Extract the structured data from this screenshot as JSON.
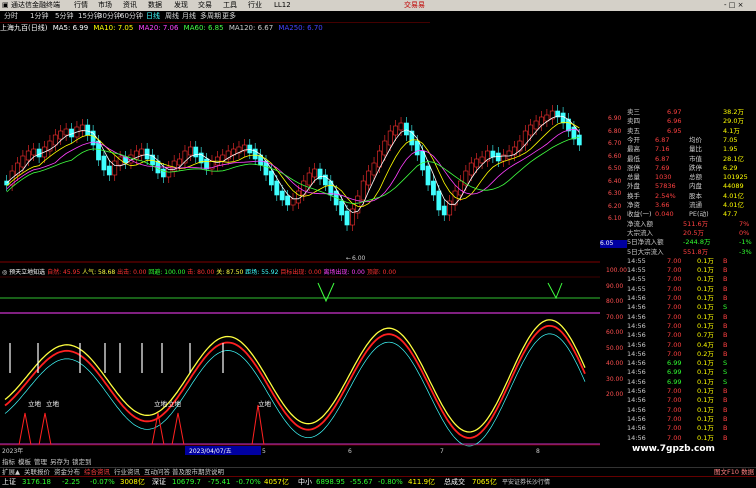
{
  "menu": {
    "app_title": "通达信金融终端",
    "items": [
      "行情",
      "市场",
      "资讯",
      "数据",
      "发现",
      "交易",
      "工具",
      "行业",
      "LL12"
    ],
    "trade_label": "交易易",
    "controls": "- □ ×"
  },
  "periods": [
    "分时",
    "1分钟",
    "5分钟",
    "15分钟",
    "30分钟",
    "60分钟",
    "日线",
    "周线",
    "月线",
    "多周期",
    "更多"
  ],
  "ma_legend": {
    "name": "上海九百(日线)",
    "items": [
      {
        "label": "MA5: 6.99",
        "color": "#ffffff"
      },
      {
        "label": "MA10: 7.05",
        "color": "#ffff00"
      },
      {
        "label": "MA20: 7.06",
        "color": "#ff40ff"
      },
      {
        "label": "MA60: 6.85",
        "color": "#40ff40"
      },
      {
        "label": "MA120: 6.67",
        "color": "#c0c0c0"
      },
      {
        "label": "MA250: 6.70",
        "color": "#4040ff"
      }
    ]
  },
  "price_axis": [
    "6.90",
    "6.80",
    "6.70",
    "6.60",
    "6.50",
    "6.40",
    "6.30",
    "6.20",
    "6.10"
  ],
  "price_marker": "6.05",
  "price_low_label": "6.00",
  "indicator_legend": {
    "name": "◎ 预天立地知选",
    "items": [
      {
        "label": "自然: 45.95",
        "color": "#ff3030"
      },
      {
        "label": "人气: 58.68",
        "color": "#ffff00"
      },
      {
        "label": "出击: 0.00",
        "color": "#ff3030"
      },
      {
        "label": "回避: 100.00",
        "color": "#40ff40"
      },
      {
        "label": "击: 80.00",
        "color": "#ff3030"
      },
      {
        "label": "关: 87.50",
        "color": "#ffff00"
      },
      {
        "label": "距场: 55.92",
        "color": "#40ffff"
      },
      {
        "label": "目标出现: 0.00",
        "color": "#ff3030"
      },
      {
        "label": "离场出现: 0.00",
        "color": "#ff40ff"
      },
      {
        "label": "顶部: 0.00",
        "color": "#ff3030"
      }
    ]
  },
  "indicator_axis": [
    "100.00",
    "90.00",
    "80.00",
    "70.00",
    "60.00",
    "50.00",
    "40.00",
    "30.00",
    "20.00"
  ],
  "annotations": [
    "立地",
    "立地",
    "立地",
    "立地",
    "立地"
  ],
  "date_label": "2023/04/07/五",
  "year_label": "2023年",
  "x_ticks": [
    "4",
    "5",
    "6",
    "7",
    "8"
  ],
  "quote": {
    "asks": [
      {
        "label": "卖三",
        "price": "6.97",
        "vol": "38.2万"
      },
      {
        "label": "卖四",
        "price": "6.96",
        "vol": "29.0万"
      },
      {
        "label": "卖五",
        "price": "6.95",
        "vol": "4.1万"
      }
    ],
    "rows": [
      {
        "l1": "今开",
        "v1": "6.87",
        "l2": "均价",
        "v2": "7.05"
      },
      {
        "l1": "最高",
        "v1": "7.16",
        "l2": "量比",
        "v2": "1.95"
      },
      {
        "l1": "最低",
        "v1": "6.87",
        "l2": "市值",
        "v2": "28.1亿"
      },
      {
        "l1": "涨停",
        "v1": "7.69",
        "l2": "跌停",
        "v2": "6.29"
      },
      {
        "l1": "总量",
        "v1": "1030",
        "l2": "总额",
        "v2": "101925"
      },
      {
        "l1": "外盘",
        "v1": "57836",
        "l2": "内盘",
        "v2": "44089"
      },
      {
        "l1": "换手",
        "v1": "2.54%",
        "l2": "股本",
        "v2": "4.01亿"
      },
      {
        "l1": "净资",
        "v1": "3.66",
        "l2": "流通",
        "v2": "4.01亿"
      },
      {
        "l1": "收益(一)",
        "v1": "0.040",
        "l2": "PE(动)",
        "v2": "47.7"
      }
    ],
    "flows": [
      {
        "label": "净流入额",
        "value": "511.6万",
        "pct": "7%"
      },
      {
        "label": "大宗流入",
        "value": "20.5万",
        "pct": "0%"
      },
      {
        "label": "5日净流入额",
        "value": "-244.8万",
        "pct": "-1%"
      },
      {
        "label": "5日大宗流入",
        "value": "551.8万",
        "pct": "-3%"
      }
    ],
    "ticks": [
      {
        "t": "14:55",
        "p": "7.00",
        "v": "0.1万",
        "d": "B"
      },
      {
        "t": "14:55",
        "p": "7.00",
        "v": "0.1万",
        "d": "B"
      },
      {
        "t": "14:55",
        "p": "7.00",
        "v": "0.1万",
        "d": "B"
      },
      {
        "t": "14:55",
        "p": "7.00",
        "v": "0.1万",
        "d": "B"
      },
      {
        "t": "14:56",
        "p": "7.00",
        "v": "0.1万",
        "d": "B"
      },
      {
        "t": "14:56",
        "p": "7.00",
        "v": "0.1万",
        "d": "S"
      },
      {
        "t": "14:56",
        "p": "7.00",
        "v": "0.1万",
        "d": "B"
      },
      {
        "t": "14:56",
        "p": "7.00",
        "v": "0.1万",
        "d": "B"
      },
      {
        "t": "14:56",
        "p": "7.00",
        "v": "0.7万",
        "d": "B"
      },
      {
        "t": "14:56",
        "p": "7.00",
        "v": "0.4万",
        "d": "B"
      },
      {
        "t": "14:56",
        "p": "7.00",
        "v": "0.2万",
        "d": "B"
      },
      {
        "t": "14:56",
        "p": "6.99",
        "v": "0.1万",
        "d": "S"
      },
      {
        "t": "14:56",
        "p": "6.99",
        "v": "0.1万",
        "d": "S"
      },
      {
        "t": "14:56",
        "p": "6.99",
        "v": "0.1万",
        "d": "S"
      },
      {
        "t": "14:56",
        "p": "7.00",
        "v": "0.1万",
        "d": "B"
      },
      {
        "t": "14:56",
        "p": "7.00",
        "v": "0.1万",
        "d": "B"
      },
      {
        "t": "14:56",
        "p": "7.00",
        "v": "0.1万",
        "d": "B"
      },
      {
        "t": "14:56",
        "p": "7.00",
        "v": "0.1万",
        "d": "B"
      },
      {
        "t": "14:56",
        "p": "7.00",
        "v": "0.1万",
        "d": "B"
      },
      {
        "t": "14:56",
        "p": "7.00",
        "v": "0.1万",
        "d": "B"
      }
    ]
  },
  "tabs1": [
    "指标",
    "模板",
    "管理",
    "另存为",
    "锁定到"
  ],
  "tabs2": [
    "扩展▲",
    "关联报价",
    "资金分布",
    "综合资讯",
    "行业资讯",
    "互动问答",
    "普及股市期货说明"
  ],
  "tabs2_right": "图文F10 数据",
  "status": [
    {
      "name": "上证",
      "val": "3176.18",
      "chg": "-2.25",
      "pct": "-0.07%",
      "amt": "3008亿"
    },
    {
      "name": "深证",
      "val": "10679.7",
      "chg": "-75.41",
      "pct": "-0.70%",
      "amt": "4057亿"
    },
    {
      "name": "中小",
      "val": "6898.95",
      "chg": "-55.67",
      "pct": "-0.80%",
      "amt": "411.9亿"
    }
  ],
  "status_tail": {
    "label": "总成交",
    "value": "7065亿",
    "source": "平安证券长沙行情"
  },
  "watermark": "www.7gpzb.com"
}
